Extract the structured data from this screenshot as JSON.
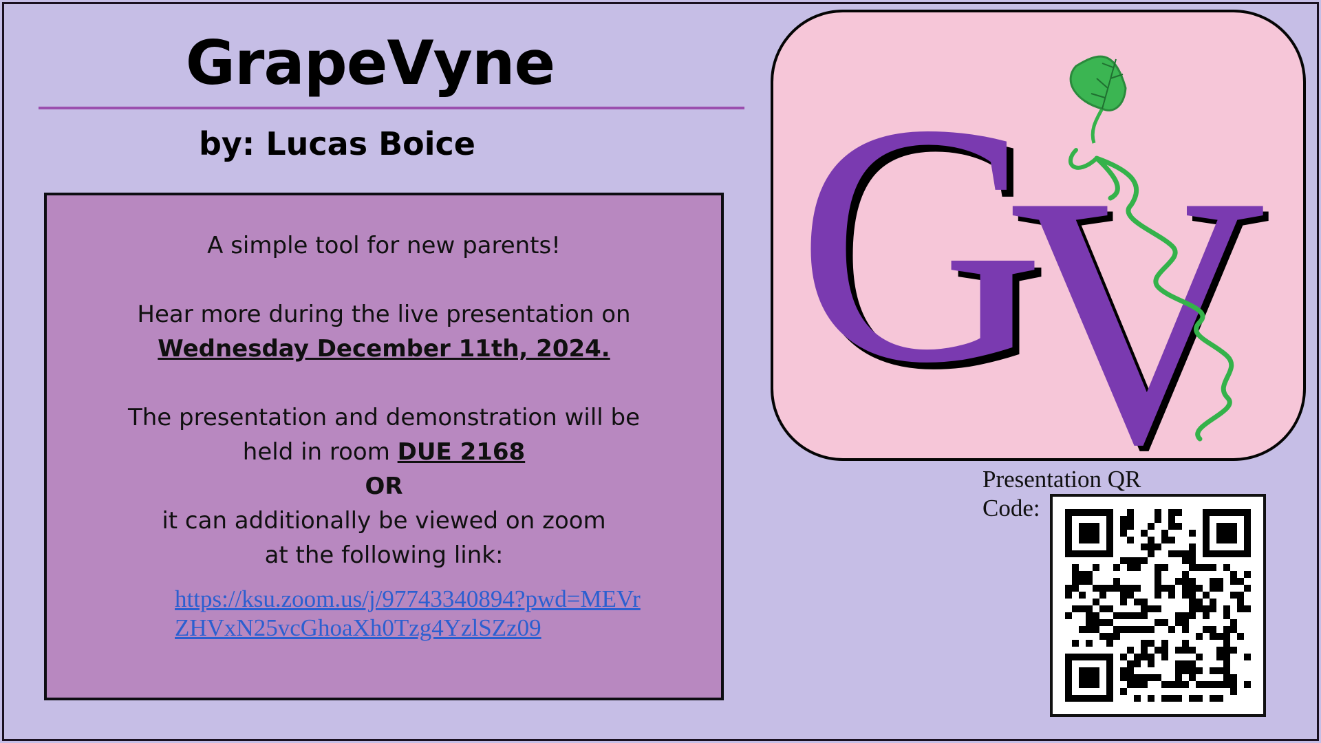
{
  "poster": {
    "title": "GrapeVyne",
    "byline": "by: Lucas Boice"
  },
  "info": {
    "tagline": "A simple tool for new parents!",
    "hear_more": "Hear more during the live presentation on",
    "date": "Wednesday December 11th, 2024.",
    "presentation_line1": "The presentation and demonstration will be",
    "presentation_line2_prefix": "held in room",
    "room": "DUE 2168",
    "or": "OR",
    "zoom_line1": "it can additionally be viewed on zoom",
    "zoom_line2": "at the following link:",
    "link": "https://ksu.zoom.us/j/97743340894?pwd=MEVrZHVxN25vcGhoaXh0Tzg4YzlSZz09"
  },
  "logo": {
    "letters": "GV",
    "letter_color": "#7a3ab0",
    "background_color": "#f6c6d8",
    "vine_color": "#34b24a",
    "leaf_icon": "leaf-icon"
  },
  "qr": {
    "label": "Presentation QR Code:"
  },
  "colors": {
    "page_background": "#c6bee6",
    "info_box": "#b888c0",
    "rule": "#9b4fae",
    "link": "#2b5fd0"
  }
}
